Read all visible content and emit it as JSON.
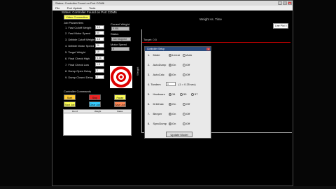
{
  "window": {
    "title": "Status: Controller Found on Port COM6",
    "menu": [
      "File",
      "Port Update",
      "Tools"
    ]
  },
  "left_panel": {
    "status": "Status: Controller Found on Port COM6",
    "video_button": "Video Connection",
    "job_params_heading": "Job Parameters",
    "params": [
      {
        "label": "1. Fast Cutoff Weight",
        "value": "4.0"
      },
      {
        "label": "2. Fast Motor Speed",
        "value": "60"
      },
      {
        "label": "3. Dribble Cutoff Weight",
        "value": "4.8"
      },
      {
        "label": "4. Dribble Motor Speed",
        "value": "20"
      },
      {
        "label": "5. Target Weight",
        "value": "15"
      },
      {
        "label": "6. Final Check High",
        "value": "5.55"
      },
      {
        "label": "7. Final Check Low",
        "value": "1.5"
      },
      {
        "label": "8. Dump Open Delay",
        "value": "2"
      },
      {
        "label": "9. Dump Closed Delay",
        "value": "2"
      }
    ],
    "current_weight_label": "Current Weight",
    "current_weight_value": "0.001",
    "status_label": "Status",
    "status_value": "Job Stopped",
    "motor_speed_label": "Motor Speed",
    "motor_speed_value": "0",
    "controller_commands": "Controller Commands",
    "commands": [
      {
        "label": "Start",
        "color": "#ffcc33"
      },
      {
        "label": "Stop",
        "color": "#ee2222"
      },
      {
        "label": "Pause",
        "color": "#ffff55"
      },
      {
        "label": "Start Job",
        "color": "#ffff55"
      },
      {
        "label": "Clear Job",
        "color": "#33ccff"
      },
      {
        "label": "Save Job",
        "color": "#ff8855"
      }
    ],
    "table_headers": [
      "Run #",
      "Weight",
      "Status"
    ]
  },
  "chart": {
    "title": "Weight vs. Time",
    "y_label": "Weight",
    "series_label": "Target: 0.5",
    "legend": "Line Plot 0",
    "line_color": "#cc0000"
  },
  "dialog": {
    "title": "Controller Setup",
    "rows": [
      {
        "num": "1.",
        "label": "Mode",
        "opt1": "Linear",
        "opt2": "Auto",
        "selected": 1
      },
      {
        "num": "2.",
        "label": "AutoDump",
        "opt1": "On",
        "opt2": "Off",
        "selected": 1
      },
      {
        "num": "3.",
        "label": "AutoCalc",
        "opt1": "On",
        "opt2": "Off",
        "selected": 1
      },
      {
        "num": "5.",
        "label": "Hardware",
        "opt1": "34",
        "opt2": "55",
        "opt3": "57",
        "selected": 1
      },
      {
        "num": "6.",
        "label": "DribCalc",
        "opt1": "On",
        "opt2": "Off",
        "selected": 1
      },
      {
        "num": "7.",
        "label": "Beeper",
        "opt1": "On",
        "opt2": "Off",
        "selected": 1
      },
      {
        "num": "8.",
        "label": "SyncDump",
        "opt1": "On",
        "opt2": "Off",
        "selected": 1
      }
    ],
    "tandem_label": "4.   Tandem",
    "tandem_value": "1",
    "tandem_hint": "(1 = 0.25 sec)",
    "update_button": "Update Model"
  }
}
